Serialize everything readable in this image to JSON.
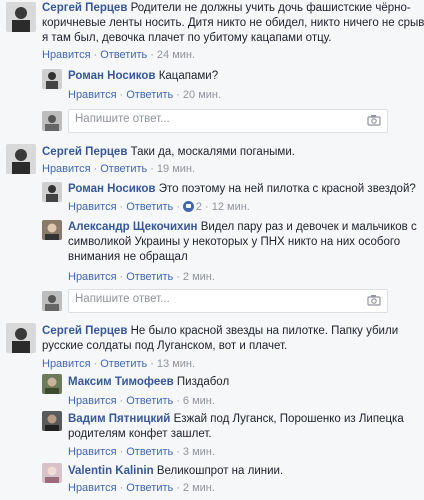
{
  "actions": {
    "like": "Нравится",
    "reply": "Ответить",
    "separator": "·"
  },
  "reply_placeholder": "Напишите ответ...",
  "threads": [
    {
      "author": "Сергей Перцев",
      "lines": [
        "Родители не должны учить дочь фашистские чёрно-",
        "коричневые ленты носить. Дитя никто не обидел, никто ничего не срывал,",
        "я там был, девочка плачет по убитому кацапами отцу."
      ],
      "time": "24 мин.",
      "replies": [
        {
          "author": "Роман Носиков",
          "lines": [
            "Кацапами?"
          ],
          "time": "20 мин."
        }
      ]
    },
    {
      "author": "Сергей Перцев",
      "lines": [
        "Таки да, москалями погаными."
      ],
      "time": "19 мин.",
      "replies": [
        {
          "author": "Роман Носиков",
          "lines": [
            "Это поэтому на ней пилотка с красной звездой?"
          ],
          "time": "12 мин.",
          "likes": "2"
        },
        {
          "author": "Александр Щекочихин",
          "lines": [
            "Видел пару раз и девочек и мальчиков с",
            "символикой Украины у некоторых у ПНХ никто на них особого",
            "внимания не обращал"
          ],
          "time": "2 мин."
        }
      ]
    },
    {
      "author": "Сергей Перцев",
      "lines": [
        "Не было красной звезды на пилотке. Папку убили",
        "русские солдаты под Луганском, вот и плачет."
      ],
      "time": "13 мин.",
      "replies": [
        {
          "author": "Максим Тимофеев",
          "lines": [
            "Пиздабол"
          ],
          "time": "6 мин."
        },
        {
          "author": "Вадим Пятницкий",
          "lines": [
            "Езжай под Луганск, Порошенко из Липецка",
            "родителям конфет зашлет."
          ],
          "time": "3 мин."
        },
        {
          "author": "Valentin Kalinin",
          "lines": [
            "Великошпрот на линии."
          ],
          "time": "2 мин."
        }
      ]
    }
  ]
}
